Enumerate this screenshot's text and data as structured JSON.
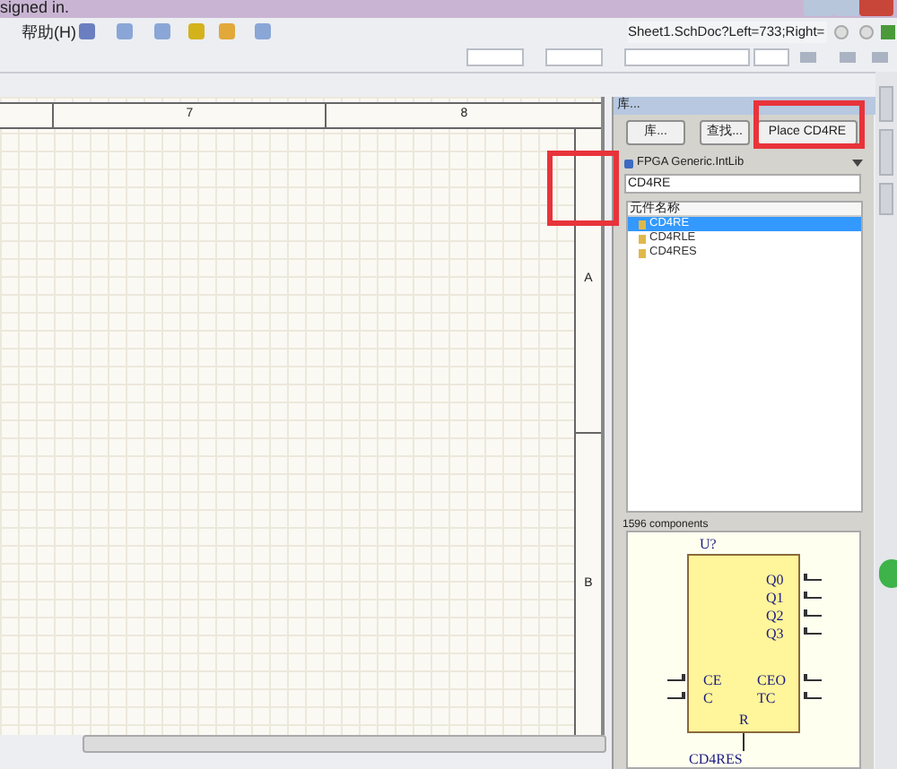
{
  "title_bar": {
    "text": "signed in."
  },
  "menu": [
    {
      "label": "帮助(H)"
    }
  ],
  "document_selector": {
    "value": "Sheet1.SchDoc?Left=733;Right="
  },
  "schematic": {
    "column_labels": [
      "7",
      "8"
    ],
    "row_labels": [
      "A",
      "B"
    ]
  },
  "library_panel": {
    "title": "库...",
    "buttons": [
      {
        "label": "库..."
      },
      {
        "label": "查找..."
      },
      {
        "label": "Place CD4RE"
      }
    ],
    "library": {
      "value": "FPGA Generic.IntLib"
    },
    "filter": {
      "value": "CD4RE"
    },
    "column_header": "元件名称",
    "components": [
      {
        "name": "CD4RE",
        "selected": true
      },
      {
        "name": "CD4RLE",
        "selected": false
      },
      {
        "name": "CD4RES",
        "selected": false
      }
    ],
    "count": "1596 components",
    "preview": {
      "designator": "U?",
      "outputs": [
        "Q0",
        "Q1",
        "Q2",
        "Q3"
      ],
      "left_pins": [
        "CE",
        "C"
      ],
      "right_pins": [
        "CEO",
        "TC"
      ],
      "bottom_pin": "R",
      "part_name": "CD4RES"
    }
  }
}
